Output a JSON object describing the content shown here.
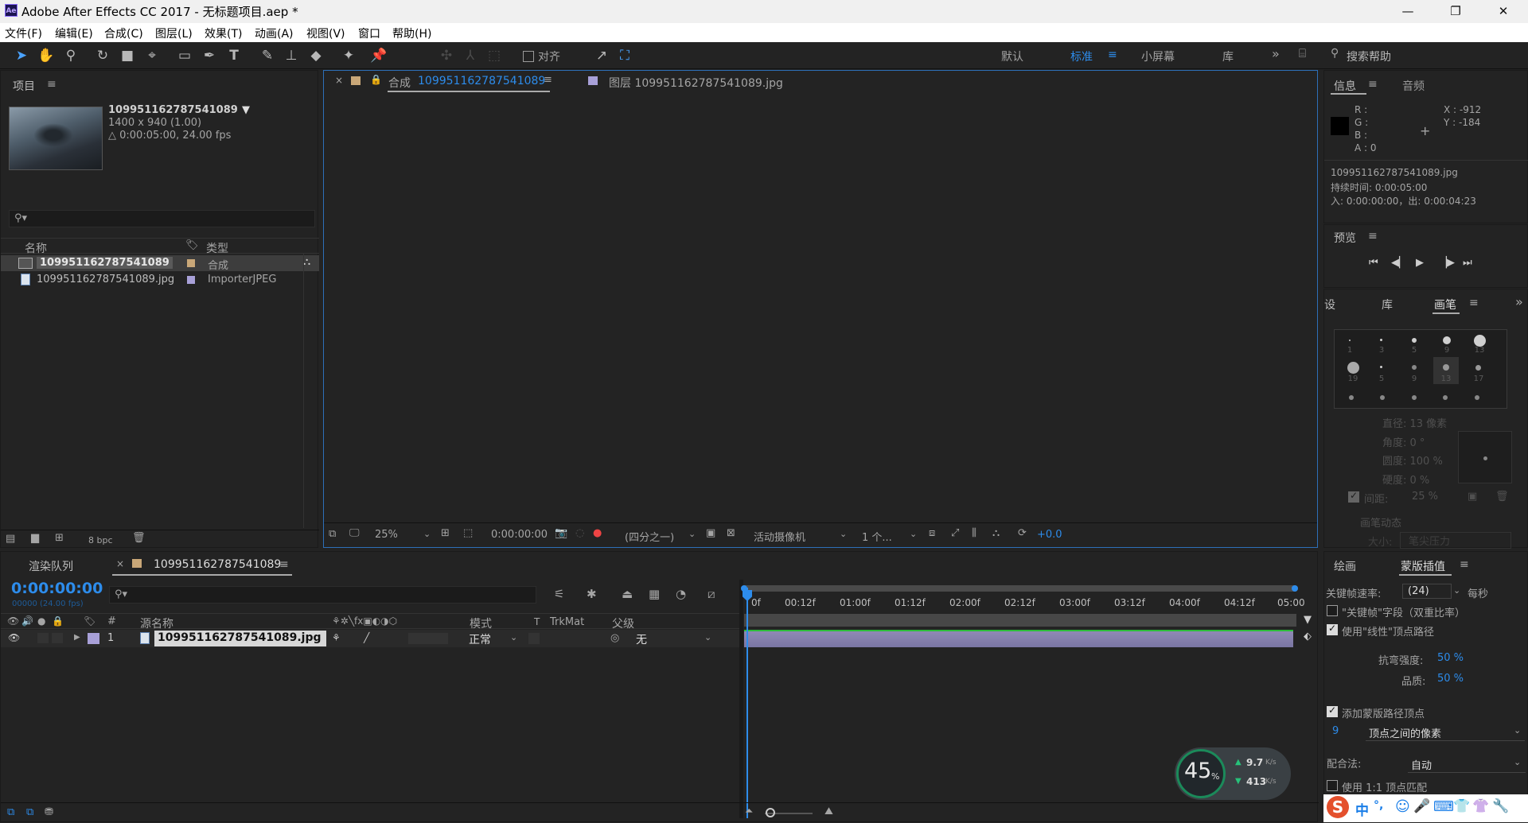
{
  "window": {
    "title": "Adobe After Effects CC 2017 - 无标题项目.aep *",
    "app_icon": "Ae",
    "minimize": "—",
    "restore": "❐",
    "close": "✕"
  },
  "menu": [
    "文件(F)",
    "编辑(E)",
    "合成(C)",
    "图层(L)",
    "效果(T)",
    "动画(A)",
    "视图(V)",
    "窗口",
    "帮助(H)"
  ],
  "toolbar": {
    "snap_label": "对齐",
    "workspaces": [
      "默认",
      "标准",
      "小屏幕",
      "库"
    ],
    "active_workspace": "标准",
    "search_placeholder": "搜索帮助"
  },
  "project": {
    "tab": "项目",
    "comp_name": "109951162787541089",
    "comp_dims": "1400 x 940 (1.00)",
    "comp_duration": "△ 0:00:05:00, 24.00 fps",
    "col_name": "名称",
    "col_type": "类型",
    "bpc": "8 bpc",
    "items": [
      {
        "name": "109951162787541089",
        "type": "合成",
        "color": "#c9a778"
      },
      {
        "name": "109951162787541089.jpg",
        "type": "ImporterJPEG",
        "color": "#a8a0d8"
      }
    ]
  },
  "viewer": {
    "tab_close": "×",
    "comp_tab_prefix": "合成",
    "comp_tab_name": "109951162787541089",
    "layer_tab": "图层 109951162787541089.jpg",
    "footer": {
      "zoom": "25%",
      "timecode": "0:00:00:00",
      "resolution": "(四分之一)",
      "camera": "活动摄像机",
      "views": "1 个...",
      "exposure": "+0.0"
    }
  },
  "info": {
    "tab": "信息",
    "tab2": "音频",
    "r": "R :",
    "g": "G :",
    "b": "B :",
    "a": "A : 0",
    "x": "X : -912",
    "y": "Y : -184",
    "file": "109951162787541089.jpg",
    "duration": "持续时间: 0:00:05:00",
    "inout": "入: 0:00:00:00，出: 0:00:04:23"
  },
  "preview": {
    "tab": "预览"
  },
  "brushes": {
    "tabs": [
      "设",
      "库",
      "画笔"
    ],
    "active": "画笔",
    "sizes": [
      "1",
      "3",
      "5",
      "9",
      "13",
      "19",
      "5",
      "9",
      "13",
      "17"
    ],
    "diameter": "直径: 13 像素",
    "angle": "角度: 0 °",
    "roundness": "圆度: 100 %",
    "hardness": "硬度: 0 %",
    "spacing_label": "间距:",
    "spacing_val": "25 %",
    "dynamics": "画笔动态",
    "size_row": "大小:",
    "size_opt": "笔尖压力"
  },
  "timeline": {
    "tabs": [
      "渲染队列",
      "109951162787541089"
    ],
    "active_tab": "109951162787541089",
    "timecode": "0:00:00:00",
    "frame_info": "00000 (24.00 fps)",
    "cols": {
      "num": "#",
      "source": "源名称",
      "mode": "模式",
      "t": "T",
      "trkmat": "TrkMat",
      "parent": "父级"
    },
    "layer": {
      "num": "1",
      "name": "109951162787541089.jpg",
      "mode": "正常",
      "parent": "无"
    },
    "ruler": [
      "0f",
      "00:12f",
      "01:00f",
      "01:12f",
      "02:00f",
      "02:12f",
      "03:00f",
      "03:12f",
      "04:00f",
      "04:12f",
      "05:00"
    ]
  },
  "mask": {
    "tabs": [
      "绘画",
      "蒙版插值"
    ],
    "active": "蒙版插值",
    "kf_rate_label": "关键帧速率:",
    "kf_rate": "(24)",
    "per_sec": "每秒",
    "field_keys": "\"关键帧\"字段（双重比率）",
    "linear": "使用\"线性\"顶点路径",
    "bend_label": "抗弯强度:",
    "bend": "50 %",
    "quality_label": "品质:",
    "quality": "50 %",
    "add_vertices": "添加蒙版路径顶点",
    "vert_num": "9",
    "vert_mode": "顶点之间的像素",
    "match_label": "配合法:",
    "match": "自动",
    "one_to_one": "使用 1:1 顶点匹配"
  },
  "net": {
    "percent": "45",
    "percent_unit": "%",
    "up": "9.7",
    "up_unit": "K/s",
    "down": "413",
    "down_unit": "K/s"
  },
  "ime": [
    "中",
    "°,",
    "☺",
    "🎤",
    "⌨",
    "👕",
    "👚",
    "🔧"
  ]
}
